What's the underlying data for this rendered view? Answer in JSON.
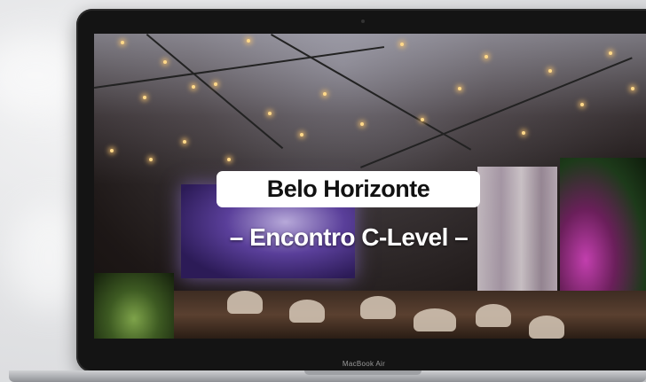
{
  "video": {
    "title": "Belo Horizonte",
    "subtitle": "– Encontro C-Level –"
  },
  "device": {
    "model_label": "MacBook Air"
  },
  "colors": {
    "background": "#e3e4e6",
    "bezel": "#141414",
    "title_pill_bg": "#ffffff",
    "title_text": "#111111",
    "subtitle_text": "#ffffff"
  }
}
